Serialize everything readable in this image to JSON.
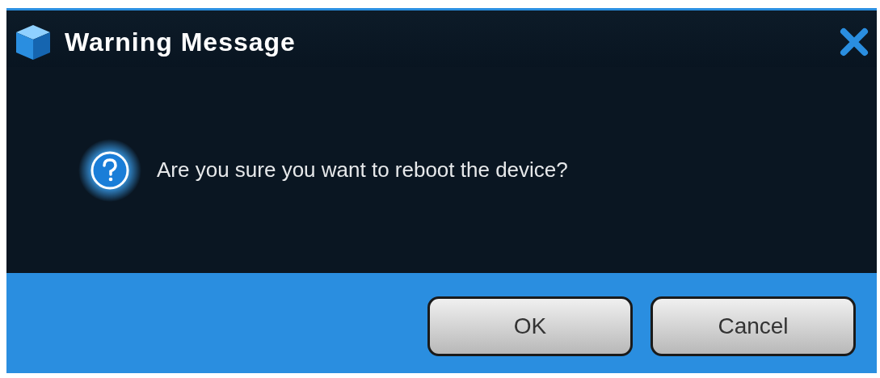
{
  "window": {
    "title": "Warning Message"
  },
  "message": "Are you sure you want to reboot the device?",
  "buttons": [
    {
      "label": "OK"
    },
    {
      "label": "Cancel"
    }
  ]
}
